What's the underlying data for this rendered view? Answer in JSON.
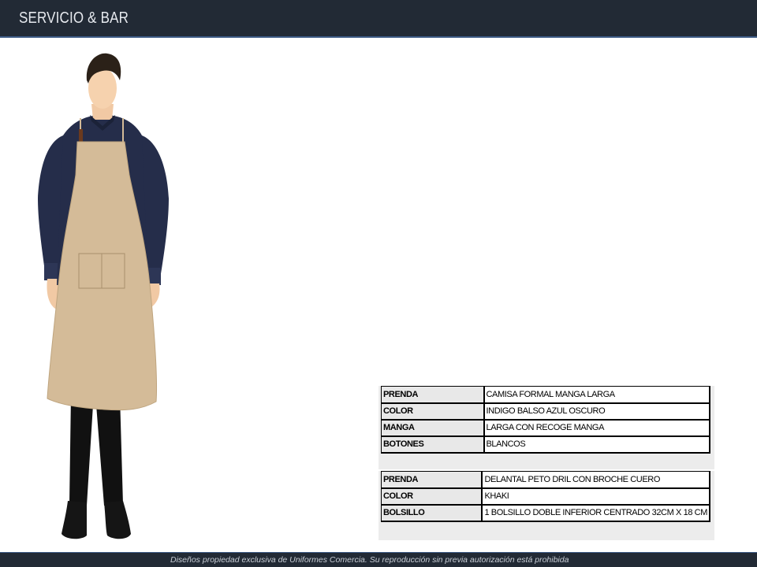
{
  "header": {
    "title": "SERVICIO & BAR"
  },
  "garments": [
    {
      "rows": [
        {
          "key": "PRENDA",
          "value": "CAMISA FORMAL MANGA LARGA"
        },
        {
          "key": "COLOR",
          "value": "INDIGO BALSO AZUL OSCURO"
        },
        {
          "key": "MANGA",
          "value": "LARGA CON RECOGE MANGA"
        },
        {
          "key": "BOTONES",
          "value": "BLANCOS"
        }
      ]
    },
    {
      "rows": [
        {
          "key": "PRENDA",
          "value": "DELANTAL PETO DRIL CON BROCHE CUERO"
        },
        {
          "key": "COLOR",
          "value": "KHAKI"
        },
        {
          "key": "BOLSILLO",
          "value": "1 BOLSILLO DOBLE INFERIOR CENTRADO 32CM X 18 CM"
        }
      ]
    }
  ],
  "colors": {
    "header_bg": "#222a35",
    "shirt": "#252d4a",
    "apron": "#d4bb98",
    "pants": "#111111"
  },
  "footer": {
    "text": "Diseños propiedad exclusiva de Uniformes Comercia. Su reproducción sin previa autorización está prohibida"
  }
}
